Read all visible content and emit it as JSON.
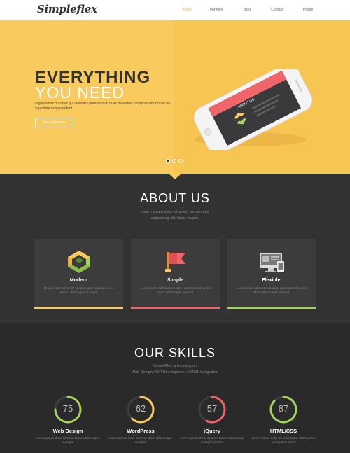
{
  "header": {
    "logo": "Simpleflex",
    "nav": [
      {
        "label": "About",
        "active": true
      },
      {
        "label": "Portfolio",
        "active": false
      },
      {
        "label": "Blog",
        "active": false
      },
      {
        "label": "Contact",
        "active": false
      },
      {
        "label": "Pages",
        "active": false
      }
    ]
  },
  "hero": {
    "title_line1": "EVERYTHING",
    "title_line2": "YOU NEED",
    "description": "Dignissimos ducimus qui blanditiis praesentium quas molestias excepturi sint occaecati cupiditate non provident",
    "button_label": "GET MORE INFO",
    "phone_screen_text": "ABOUT US",
    "slider_dots": 3,
    "active_dot": 1
  },
  "about": {
    "title": "ABOUT US",
    "subtitle_line1": "Lorem ipsum dolor sit amet, consectetur",
    "subtitle_line2": "adipisicing elit. Nam, itaque.",
    "cards": [
      {
        "title": "Modern",
        "text": "Ut wisi enim ad minim veniam, quis nostrud exerci tation ullamcorper suscipit.",
        "icon": "recycle-arrows-icon",
        "accent": "#f9ca5e"
      },
      {
        "title": "Simple",
        "text": "Ut wisi enim ad minim veniam, quis nostrud exerci tation ullamcorper suscipit.",
        "icon": "flag-icon",
        "accent": "#f0646a"
      },
      {
        "title": "Flexible",
        "text": "Ut wisi enim ad minim veniam, quis nostrud exerci tation ullamcorper suscipit.",
        "icon": "devices-icon",
        "accent": "#a6d35f"
      }
    ]
  },
  "skills": {
    "title": "OUR SKILLS",
    "subtitle_line1": "SimpleFlex is focusing on",
    "subtitle_line2": "Web Design / WP Development / HTML Integration",
    "items": [
      {
        "name": "Web Design",
        "value": 75,
        "text": "Lorem ipsum dolor sit amet tation ullamcorper suscipit.",
        "color": "#a6d35f"
      },
      {
        "name": "WordPress",
        "value": 62,
        "text": "Lorem ipsum dolor sit amet tation ullamcorper suscipit.",
        "color": "#f9ca5e"
      },
      {
        "name": "jQuery",
        "value": 57,
        "text": "Lorem ipsum dolor sit amet tation ullamcorper suscipit sit amet",
        "color": "#f0646a"
      },
      {
        "name": "HTML/CSS",
        "value": 87,
        "text": "Lorem ipsum dolor sit amet tation ullamcorper suscipit sit amet",
        "color": "#a6d35f"
      }
    ]
  }
}
